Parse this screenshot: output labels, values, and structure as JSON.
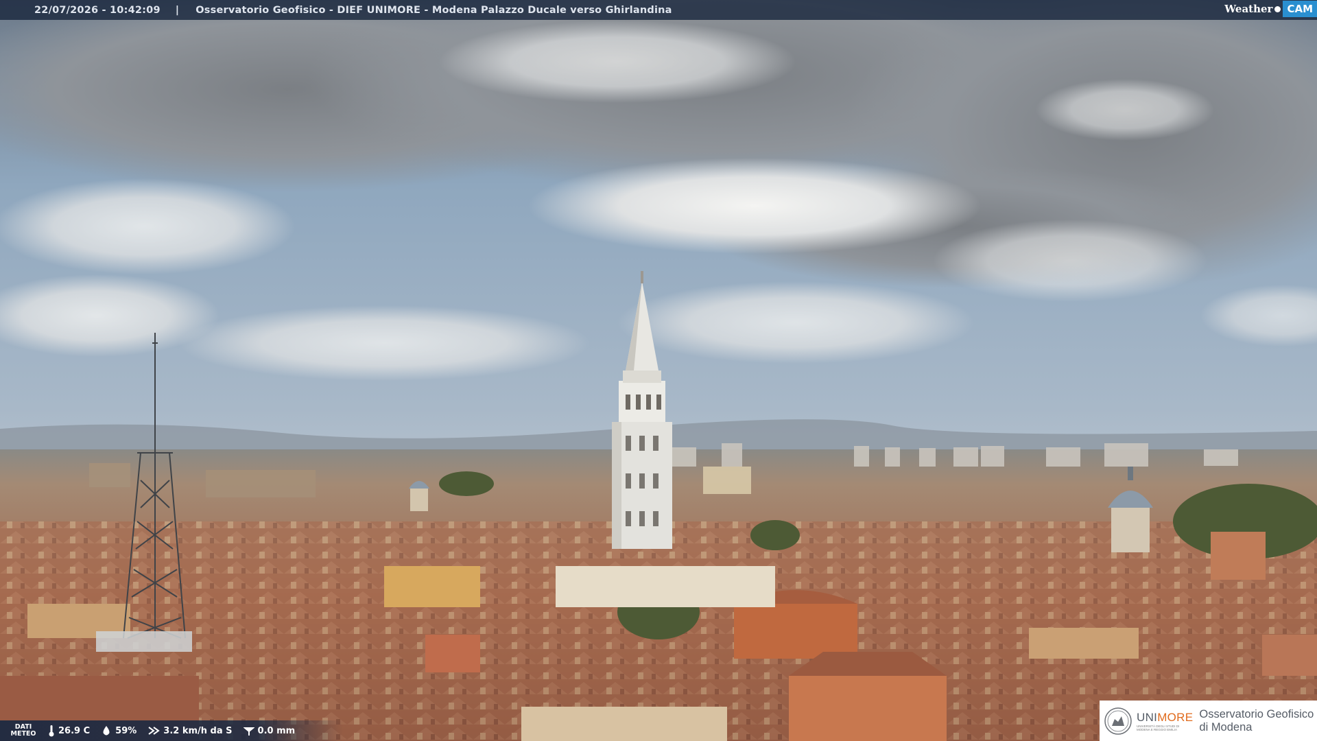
{
  "header": {
    "timestamp": "22/07/2026 - 10:42:09",
    "separator": "|",
    "title": "Osservatorio Geofisico - DIEF UNIMORE - Modena Palazzo Ducale verso Ghirlandina",
    "logo": {
      "word": "Weather",
      "cam": "CAM"
    }
  },
  "weather": {
    "label_line1": "DATI",
    "label_line2": "METEO",
    "temperature": "26.9 C",
    "humidity": "59%",
    "wind": "3.2 km/h da S",
    "rain": "0.0 mm",
    "icons": [
      "thermometer-icon",
      "humidity-drop-icon",
      "wind-icon",
      "rain-gauge-icon"
    ]
  },
  "footer_logo": {
    "brand_prefix": "UNI",
    "brand_suffix": "MORE",
    "brand_sub": "UNIVERSITÀ DEGLI STUDI DI MODENA E REGGIO EMILIA",
    "org_line1": "Osservatorio Geofisico",
    "org_line2": "di Modena"
  },
  "colors": {
    "bar_bg": "#18263c",
    "brand_orange": "#e06a1c",
    "cam_blue": "#2a8fd0",
    "sky": "#8fa7be",
    "roof": "#b7775a"
  }
}
